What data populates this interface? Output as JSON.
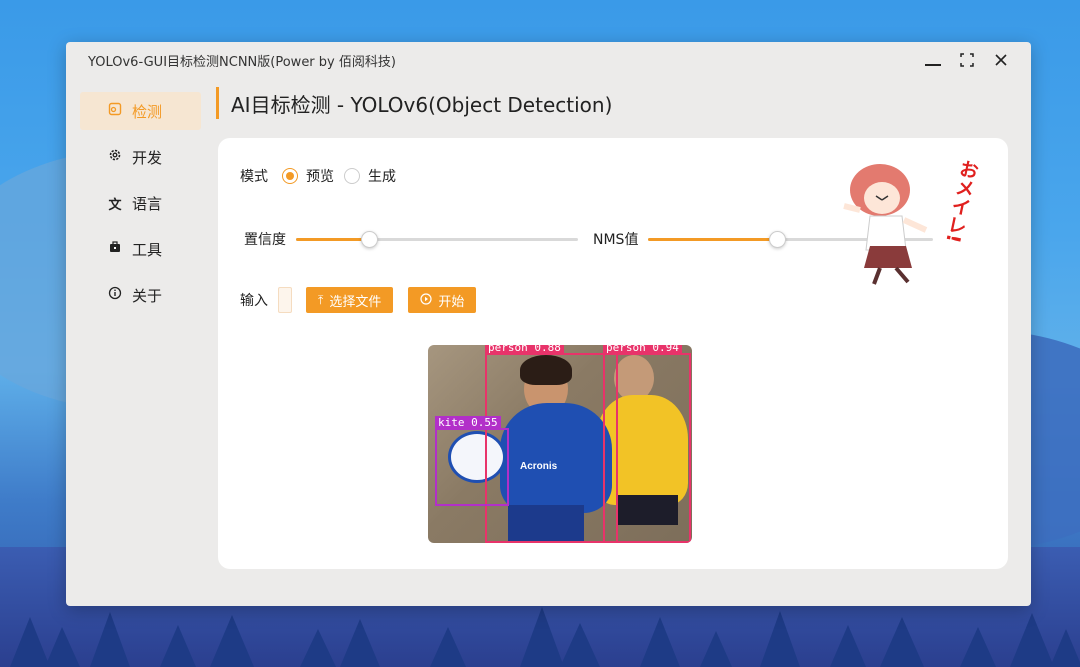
{
  "window": {
    "title": "YOLOv6-GUI目标检测NCNN版(Power by 佰阅科技)"
  },
  "sidebar": {
    "items": [
      {
        "label": "检测",
        "icon": "detect-icon",
        "active": true
      },
      {
        "label": "开发",
        "icon": "gear-icon",
        "active": false
      },
      {
        "label": "语言",
        "icon": "translate-icon",
        "active": false
      },
      {
        "label": "工具",
        "icon": "toolbox-icon",
        "active": false
      },
      {
        "label": "关于",
        "icon": "info-icon",
        "active": false
      }
    ]
  },
  "page": {
    "title": "AI目标检测 - YOLOv6(Object Detection)"
  },
  "mode": {
    "label": "模式",
    "options": [
      "预览",
      "生成"
    ],
    "selected": "预览"
  },
  "confidence": {
    "label": "置信度",
    "value": 0.26
  },
  "nms": {
    "label": "NMS值",
    "value": 0.45
  },
  "input": {
    "label": "输入",
    "select_file_label": "选择文件",
    "start_label": "开始"
  },
  "detections": [
    {
      "label": "person 0.88",
      "color": "#e8336a"
    },
    {
      "label": "person 0.94",
      "color": "#e8336a"
    },
    {
      "label": "kite 0.55",
      "color": "#b22fc9"
    }
  ],
  "mascot": {
    "text": "おメイレ!"
  },
  "colors": {
    "accent": "#f39a25",
    "active_bg": "#f6e6d2"
  }
}
